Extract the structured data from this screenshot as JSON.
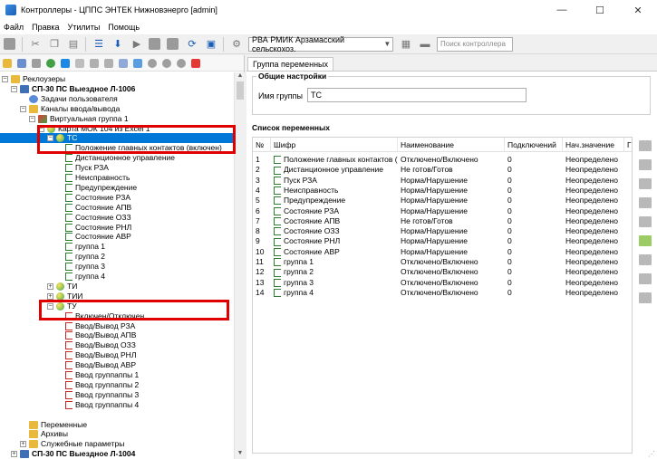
{
  "window": {
    "title": "Контроллеры - ЦППС ЭНТЕК Нижновэнерго [admin]",
    "minimize": "—",
    "maximize": "☐",
    "close": "✕"
  },
  "menu": [
    "Файл",
    "Правка",
    "Утилиты",
    "Помощь"
  ],
  "toolbar": {
    "controller_combo": "РВА РМИК Арзамасский сельскохоз.",
    "search_placeholder": "Поиск контроллера"
  },
  "tree": {
    "items": [
      {
        "label": "Реклоузеры",
        "indent": 0,
        "icon": "folder-icon",
        "expander": "−"
      },
      {
        "label": "СП-30 ПС Выездное Л-1006",
        "indent": 1,
        "icon": "device-icon",
        "expander": "−",
        "bold": true
      },
      {
        "label": "Задачи пользователя",
        "indent": 2,
        "icon": "task-icon",
        "expander": ""
      },
      {
        "label": "Каналы ввода/вывода",
        "indent": 2,
        "icon": "folder-icon",
        "expander": "−"
      },
      {
        "label": "Виртуальная группа 1",
        "indent": 3,
        "icon": "virtual-group-icon",
        "expander": "−"
      },
      {
        "label": "Карта МОК 104 из Excel 1",
        "indent": 4,
        "icon": "ball-icon",
        "expander": "−"
      },
      {
        "label": "ТС",
        "indent": 5,
        "icon": "ball-icon",
        "expander": "−",
        "selected": true
      },
      {
        "label": "Положение главных контактов (включен)",
        "indent": 6,
        "icon": "signal-icon",
        "expander": ""
      },
      {
        "label": "Дистанционное управление",
        "indent": 6,
        "icon": "signal-icon",
        "expander": ""
      },
      {
        "label": "Пуск РЗА",
        "indent": 6,
        "icon": "signal-icon",
        "expander": ""
      },
      {
        "label": "Неисправность",
        "indent": 6,
        "icon": "signal-icon",
        "expander": ""
      },
      {
        "label": "Предупреждение",
        "indent": 6,
        "icon": "signal-icon",
        "expander": ""
      },
      {
        "label": "Состояние РЗА",
        "indent": 6,
        "icon": "signal-icon",
        "expander": ""
      },
      {
        "label": "Состояние АПВ",
        "indent": 6,
        "icon": "signal-icon",
        "expander": ""
      },
      {
        "label": "Состояние ОЗЗ",
        "indent": 6,
        "icon": "signal-icon",
        "expander": ""
      },
      {
        "label": "Состояние РНЛ",
        "indent": 6,
        "icon": "signal-icon",
        "expander": ""
      },
      {
        "label": "Состояние АВР",
        "indent": 6,
        "icon": "signal-icon",
        "expander": ""
      },
      {
        "label": "группа 1",
        "indent": 6,
        "icon": "signal-icon",
        "expander": ""
      },
      {
        "label": "группа 2",
        "indent": 6,
        "icon": "signal-icon",
        "expander": ""
      },
      {
        "label": "группа 3",
        "indent": 6,
        "icon": "signal-icon",
        "expander": ""
      },
      {
        "label": "группа 4",
        "indent": 6,
        "icon": "signal-icon",
        "expander": ""
      },
      {
        "label": "ТИ",
        "indent": 5,
        "icon": "ball-icon",
        "expander": "+"
      },
      {
        "label": "ТИИ",
        "indent": 5,
        "icon": "ball-icon",
        "expander": "+"
      },
      {
        "label": "ТУ",
        "indent": 5,
        "icon": "ball-icon",
        "expander": "−"
      },
      {
        "label": "Включен/Отключен",
        "indent": 6,
        "icon": "signal-red-icon",
        "expander": ""
      },
      {
        "label": "Ввод/Вывод РЗА",
        "indent": 6,
        "icon": "signal-red-icon",
        "expander": ""
      },
      {
        "label": "Ввод/Вывод АПВ",
        "indent": 6,
        "icon": "signal-red-icon",
        "expander": ""
      },
      {
        "label": "Ввод/Вывод ОЗЗ",
        "indent": 6,
        "icon": "signal-red-icon",
        "expander": ""
      },
      {
        "label": "Ввод/Вывод РНЛ",
        "indent": 6,
        "icon": "signal-red-icon",
        "expander": ""
      },
      {
        "label": "Ввод/Вывод АВР",
        "indent": 6,
        "icon": "signal-red-icon",
        "expander": ""
      },
      {
        "label": "Ввод группаппы 1",
        "indent": 6,
        "icon": "signal-red-icon",
        "expander": ""
      },
      {
        "label": "Ввод группаппы 2",
        "indent": 6,
        "icon": "signal-red-icon",
        "expander": ""
      },
      {
        "label": "Ввод группаппы 3",
        "indent": 6,
        "icon": "signal-red-icon",
        "expander": ""
      },
      {
        "label": "Ввод группаппы 4",
        "indent": 6,
        "icon": "signal-red-icon",
        "expander": ""
      },
      {
        "label": "",
        "indent": 0,
        "icon": "",
        "expander": ""
      },
      {
        "label": "Переменные",
        "indent": 2,
        "icon": "folder-icon",
        "expander": ""
      },
      {
        "label": "Архивы",
        "indent": 2,
        "icon": "folder-icon",
        "expander": ""
      },
      {
        "label": "Служебные параметры",
        "indent": 2,
        "icon": "folder-icon",
        "expander": "+"
      },
      {
        "label": "СП-30 ПС Выездное Л-1004",
        "indent": 1,
        "icon": "device-icon",
        "expander": "+",
        "bold": true
      }
    ]
  },
  "right": {
    "tab": "Группа переменных",
    "general_legend": "Общие настройки",
    "group_name_label": "Имя группы",
    "group_name_value": "ТС",
    "list_header": "Список переменных",
    "columns": [
      "№",
      "Шифр",
      "Наименование",
      "Подключений",
      "Нач.значение",
      "Г"
    ],
    "rows": [
      [
        "1",
        "Положение главных контактов (в...",
        "Отключено/Включено",
        "0",
        "Неопределено"
      ],
      [
        "2",
        "Дистанционное управление",
        "Не готов/Готов",
        "0",
        "Неопределено"
      ],
      [
        "3",
        "Пуск РЗА",
        "Норма/Нарушение",
        "0",
        "Неопределено"
      ],
      [
        "4",
        "Неисправность",
        "Норма/Нарушение",
        "0",
        "Неопределено"
      ],
      [
        "5",
        "Предупреждение",
        "Норма/Нарушение",
        "0",
        "Неопределено"
      ],
      [
        "6",
        "Состояние РЗА",
        "Норма/Нарушение",
        "0",
        "Неопределено"
      ],
      [
        "7",
        "Состояние АПВ",
        "Не готов/Готов",
        "0",
        "Неопределено"
      ],
      [
        "8",
        "Состояние ОЗЗ",
        "Норма/Нарушение",
        "0",
        "Неопределено"
      ],
      [
        "9",
        "Состояние РНЛ",
        "Норма/Нарушение",
        "0",
        "Неопределено"
      ],
      [
        "10",
        "Состояние АВР",
        "Норма/Нарушение",
        "0",
        "Неопределено"
      ],
      [
        "11",
        "группа 1",
        "Отключено/Включено",
        "0",
        "Неопределено"
      ],
      [
        "12",
        "группа 2",
        "Отключено/Включено",
        "0",
        "Неопределено"
      ],
      [
        "13",
        "группа 3",
        "Отключено/Включено",
        "0",
        "Неопределено"
      ],
      [
        "14",
        "группа 4",
        "Отключено/Включено",
        "0",
        "Неопределено"
      ]
    ]
  },
  "colors": {
    "selection": "#0078d7",
    "highlight": "#e00000"
  }
}
